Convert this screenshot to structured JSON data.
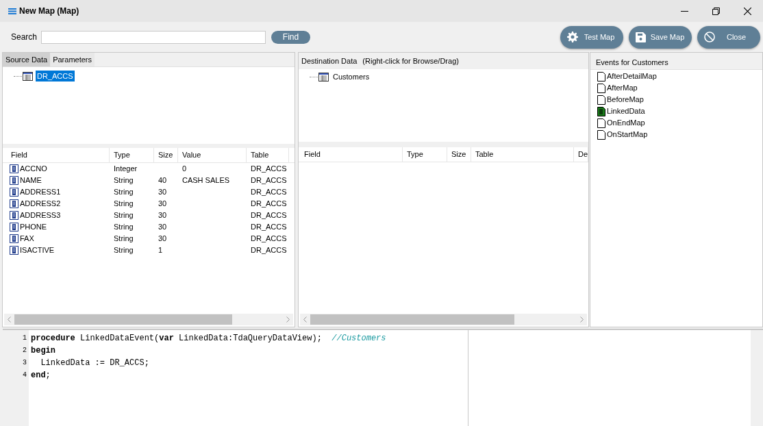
{
  "window": {
    "title": "New Map (Map)"
  },
  "toolbar": {
    "search_label": "Search",
    "find_button": "Find",
    "buttons": [
      {
        "kind": "gear",
        "label": "Test Map"
      },
      {
        "kind": "save",
        "label": "Save Map"
      },
      {
        "kind": "cancel",
        "label": "Close"
      }
    ]
  },
  "source": {
    "tabs": [
      {
        "label": "Source Data",
        "selected": true
      },
      {
        "label": "Parameters",
        "selected": false
      }
    ],
    "tree": [
      {
        "label": "DR_ACCS",
        "selected": true
      }
    ],
    "columns": [
      "Field",
      "Type",
      "Size",
      "Value",
      "Table"
    ],
    "rows": [
      {
        "cells": [
          "ACCNO",
          "Integer",
          "",
          "0",
          "DR_ACCS"
        ]
      },
      {
        "cells": [
          "NAME",
          "String",
          "40",
          "CASH SALES",
          "DR_ACCS"
        ]
      },
      {
        "cells": [
          "ADDRESS1",
          "String",
          "30",
          "",
          "DR_ACCS"
        ]
      },
      {
        "cells": [
          "ADDRESS2",
          "String",
          "30",
          "",
          "DR_ACCS"
        ]
      },
      {
        "cells": [
          "ADDRESS3",
          "String",
          "30",
          "",
          "DR_ACCS"
        ]
      },
      {
        "cells": [
          "PHONE",
          "String",
          "30",
          "",
          "DR_ACCS"
        ]
      },
      {
        "cells": [
          "FAX",
          "String",
          "30",
          "",
          "DR_ACCS"
        ]
      },
      {
        "cells": [
          "ISACTIVE",
          "String",
          "1",
          "",
          "DR_ACCS"
        ]
      }
    ]
  },
  "destination": {
    "header": "Destination Data",
    "hint": "(Right-click for Browse/Drag)",
    "tree": [
      {
        "label": "Customers",
        "selected": false
      }
    ],
    "columns": [
      "Field",
      "Type",
      "Size",
      "Table",
      "De"
    ]
  },
  "events": {
    "header": "Events for Customers",
    "items": [
      {
        "label": "AfterDetailMap",
        "has_code": false
      },
      {
        "label": "AfterMap",
        "has_code": false
      },
      {
        "label": "BeforeMap",
        "has_code": false
      },
      {
        "label": "LinkedData",
        "has_code": true
      },
      {
        "label": "OnEndMap",
        "has_code": false
      },
      {
        "label": "OnStartMap",
        "has_code": false
      }
    ]
  },
  "editor": {
    "lines": [
      {
        "number": "1",
        "segments": [
          {
            "kind": "keyword",
            "text": "procedure"
          },
          {
            "kind": "plain",
            "text": " LinkedDataEvent("
          },
          {
            "kind": "keyword",
            "text": "var"
          },
          {
            "kind": "plain",
            "text": " LinkedData:TdaQueryDataView);  "
          },
          {
            "kind": "comment",
            "text": "//Customers"
          }
        ]
      },
      {
        "number": "2",
        "segments": [
          {
            "kind": "keyword",
            "text": "begin"
          }
        ]
      },
      {
        "number": "3",
        "segments": [
          {
            "kind": "plain",
            "text": "  LinkedData := DR_ACCS;"
          }
        ]
      },
      {
        "number": "4",
        "segments": [
          {
            "kind": "keyword",
            "text": "end"
          },
          {
            "kind": "plain",
            "text": ";"
          }
        ]
      }
    ]
  }
}
